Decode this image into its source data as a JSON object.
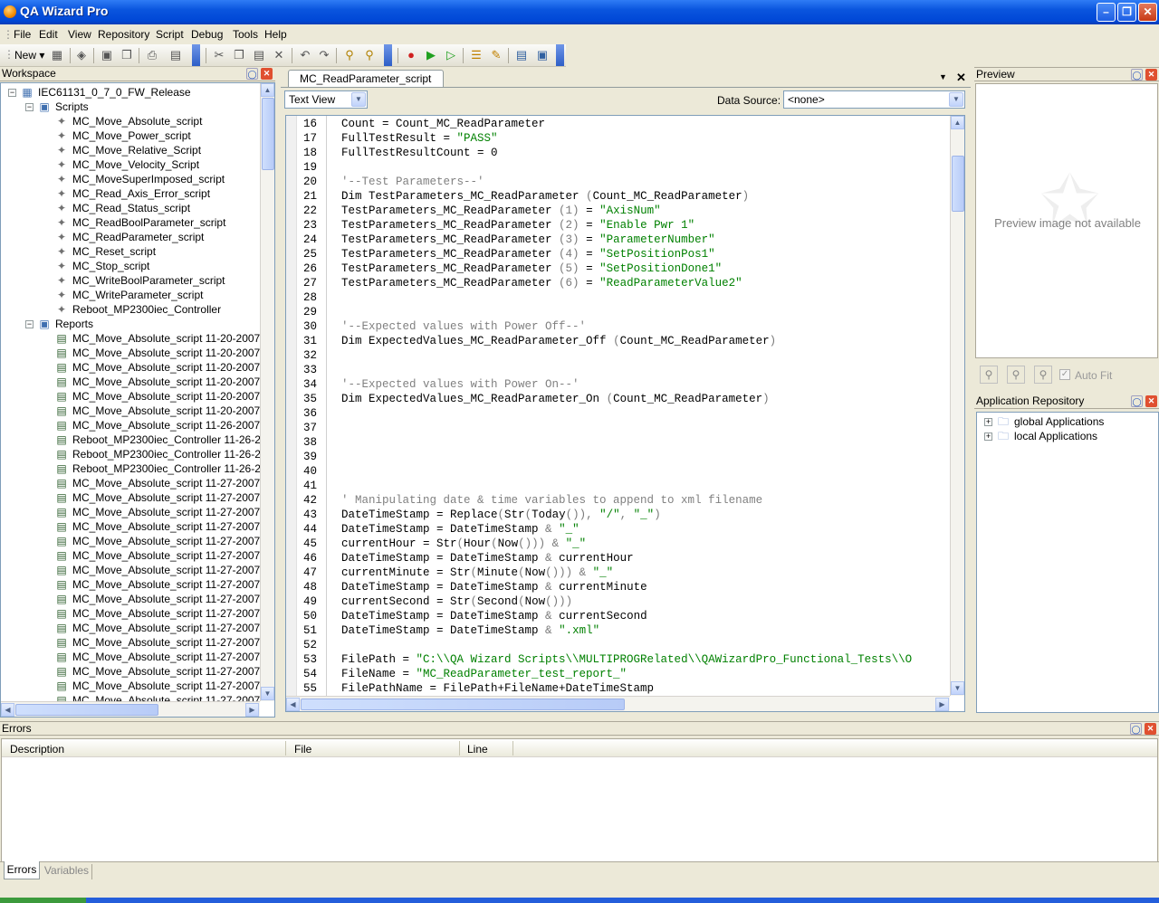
{
  "window": {
    "title": "QA Wizard Pro"
  },
  "menu": [
    "File",
    "Edit",
    "View",
    "Repository",
    "Script",
    "Debug",
    "Tools",
    "Help"
  ],
  "toolbar": {
    "new_label": "New"
  },
  "workspace": {
    "title": "Workspace",
    "root": "IEC61131_0_7_0_FW_Release",
    "scripts_folder": "Scripts",
    "scripts": [
      "MC_Move_Absolute_script",
      "MC_Move_Power_script",
      "MC_Move_Relative_Script",
      "MC_Move_Velocity_Script",
      "MC_MoveSuperImposed_script",
      "MC_Read_Axis_Error_script",
      "MC_Read_Status_script",
      "MC_ReadBoolParameter_script",
      "MC_ReadParameter_script",
      "MC_Reset_script",
      "MC_Stop_script",
      "MC_WriteBoolParameter_script",
      "MC_WriteParameter_script",
      "Reboot_MP2300iec_Controller"
    ],
    "reports_folder": "Reports",
    "reports": [
      "MC_Move_Absolute_script 11-20-2007",
      "MC_Move_Absolute_script 11-20-2007",
      "MC_Move_Absolute_script 11-20-2007",
      "MC_Move_Absolute_script 11-20-2007",
      "MC_Move_Absolute_script 11-20-2007",
      "MC_Move_Absolute_script 11-20-2007",
      "MC_Move_Absolute_script 11-26-2007",
      "Reboot_MP2300iec_Controller 11-26-20",
      "Reboot_MP2300iec_Controller 11-26-20",
      "Reboot_MP2300iec_Controller 11-26-20",
      "MC_Move_Absolute_script 11-27-2007",
      "MC_Move_Absolute_script 11-27-2007",
      "MC_Move_Absolute_script 11-27-2007",
      "MC_Move_Absolute_script 11-27-2007",
      "MC_Move_Absolute_script 11-27-2007",
      "MC_Move_Absolute_script 11-27-2007",
      "MC_Move_Absolute_script 11-27-2007",
      "MC_Move_Absolute_script 11-27-2007",
      "MC_Move_Absolute_script 11-27-2007",
      "MC_Move_Absolute_script 11-27-2007",
      "MC_Move_Absolute_script 11-27-2007",
      "MC_Move_Absolute_script 11-27-2007",
      "MC_Move_Absolute_script 11-27-2007",
      "MC_Move_Absolute_script 11-27-2007",
      "MC_Move_Absolute_script 11-27-2007",
      "MC_Move_Absolute_script 11-27-2007"
    ]
  },
  "editor": {
    "tab": "MC_ReadParameter_script",
    "view_mode": "Text View",
    "data_source_label": "Data Source:",
    "data_source_value": "<none>",
    "lines": [
      {
        "n": "16",
        "segs": [
          [
            "Count = Count_MC_ReadParameter",
            ""
          ]
        ]
      },
      {
        "n": "17",
        "segs": [
          [
            "FullTestResult = ",
            ""
          ],
          [
            "\"PASS\"",
            "str"
          ]
        ]
      },
      {
        "n": "18",
        "segs": [
          [
            "FullTestResultCount = 0",
            ""
          ]
        ]
      },
      {
        "n": "19",
        "segs": []
      },
      {
        "n": "20",
        "segs": [
          [
            "'--Test Parameters--'",
            "cmt"
          ]
        ]
      },
      {
        "n": "21",
        "segs": [
          [
            "Dim TestParameters_MC_ReadParameter ",
            ""
          ],
          [
            "(",
            "pnc"
          ],
          [
            "Count_MC_ReadParameter",
            ""
          ],
          [
            ")",
            "pnc"
          ]
        ]
      },
      {
        "n": "22",
        "segs": [
          [
            "TestParameters_MC_ReadParameter ",
            ""
          ],
          [
            "(1)",
            "pnc"
          ],
          [
            " = ",
            ""
          ],
          [
            "\"AxisNum\"",
            "str"
          ]
        ]
      },
      {
        "n": "23",
        "segs": [
          [
            "TestParameters_MC_ReadParameter ",
            ""
          ],
          [
            "(2)",
            "pnc"
          ],
          [
            " = ",
            ""
          ],
          [
            "\"Enable Pwr 1\"",
            "str"
          ]
        ]
      },
      {
        "n": "24",
        "segs": [
          [
            "TestParameters_MC_ReadParameter ",
            ""
          ],
          [
            "(3)",
            "pnc"
          ],
          [
            " = ",
            ""
          ],
          [
            "\"ParameterNumber\"",
            "str"
          ]
        ]
      },
      {
        "n": "25",
        "segs": [
          [
            "TestParameters_MC_ReadParameter ",
            ""
          ],
          [
            "(4)",
            "pnc"
          ],
          [
            " = ",
            ""
          ],
          [
            "\"SetPositionPos1\"",
            "str"
          ]
        ]
      },
      {
        "n": "26",
        "segs": [
          [
            "TestParameters_MC_ReadParameter ",
            ""
          ],
          [
            "(5)",
            "pnc"
          ],
          [
            " = ",
            ""
          ],
          [
            "\"SetPositionDone1\"",
            "str"
          ]
        ]
      },
      {
        "n": "27",
        "segs": [
          [
            "TestParameters_MC_ReadParameter ",
            ""
          ],
          [
            "(6)",
            "pnc"
          ],
          [
            " = ",
            ""
          ],
          [
            "\"ReadParameterValue2\"",
            "str"
          ]
        ]
      },
      {
        "n": "28",
        "segs": []
      },
      {
        "n": "29",
        "segs": []
      },
      {
        "n": "30",
        "segs": [
          [
            "'--Expected values with Power Off--'",
            "cmt"
          ]
        ]
      },
      {
        "n": "31",
        "segs": [
          [
            "Dim ExpectedValues_MC_ReadParameter_Off ",
            ""
          ],
          [
            "(",
            "pnc"
          ],
          [
            "Count_MC_ReadParameter",
            ""
          ],
          [
            ")",
            "pnc"
          ]
        ]
      },
      {
        "n": "32",
        "segs": []
      },
      {
        "n": "33",
        "segs": []
      },
      {
        "n": "34",
        "segs": [
          [
            "'--Expected values with Power On--'",
            "cmt"
          ]
        ]
      },
      {
        "n": "35",
        "segs": [
          [
            "Dim ExpectedValues_MC_ReadParameter_On ",
            ""
          ],
          [
            "(",
            "pnc"
          ],
          [
            "Count_MC_ReadParameter",
            ""
          ],
          [
            ")",
            "pnc"
          ]
        ]
      },
      {
        "n": "36",
        "segs": []
      },
      {
        "n": "37",
        "segs": []
      },
      {
        "n": "38",
        "segs": []
      },
      {
        "n": "39",
        "segs": []
      },
      {
        "n": "40",
        "segs": []
      },
      {
        "n": "41",
        "segs": []
      },
      {
        "n": "42",
        "segs": [
          [
            "' Manipulating date & time variables to append to xml filename",
            "cmt"
          ]
        ]
      },
      {
        "n": "43",
        "segs": [
          [
            "DateTimeStamp = Replace",
            ""
          ],
          [
            "(",
            "pnc"
          ],
          [
            "Str",
            ""
          ],
          [
            "(",
            "pnc"
          ],
          [
            "Today",
            ""
          ],
          [
            "()),",
            "pnc"
          ],
          [
            " ",
            ""
          ],
          [
            "\"/\"",
            "str"
          ],
          [
            ",",
            "pnc"
          ],
          [
            " ",
            ""
          ],
          [
            "\"_\"",
            "str"
          ],
          [
            ")",
            "pnc"
          ]
        ]
      },
      {
        "n": "44",
        "segs": [
          [
            "DateTimeStamp = DateTimeStamp ",
            ""
          ],
          [
            "&",
            "pnc"
          ],
          [
            " ",
            ""
          ],
          [
            "\"_\"",
            "str"
          ]
        ]
      },
      {
        "n": "45",
        "segs": [
          [
            "currentHour = Str",
            ""
          ],
          [
            "(",
            "pnc"
          ],
          [
            "Hour",
            ""
          ],
          [
            "(",
            "pnc"
          ],
          [
            "Now",
            ""
          ],
          [
            "()))",
            "pnc"
          ],
          [
            " ",
            ""
          ],
          [
            "&",
            "pnc"
          ],
          [
            " ",
            ""
          ],
          [
            "\"_\"",
            "str"
          ]
        ]
      },
      {
        "n": "46",
        "segs": [
          [
            "DateTimeStamp = DateTimeStamp ",
            ""
          ],
          [
            "&",
            "pnc"
          ],
          [
            " currentHour",
            ""
          ]
        ]
      },
      {
        "n": "47",
        "segs": [
          [
            "currentMinute = Str",
            ""
          ],
          [
            "(",
            "pnc"
          ],
          [
            "Minute",
            ""
          ],
          [
            "(",
            "pnc"
          ],
          [
            "Now",
            ""
          ],
          [
            "()))",
            "pnc"
          ],
          [
            " ",
            ""
          ],
          [
            "&",
            "pnc"
          ],
          [
            " ",
            ""
          ],
          [
            "\"_\"",
            "str"
          ]
        ]
      },
      {
        "n": "48",
        "segs": [
          [
            "DateTimeStamp = DateTimeStamp ",
            ""
          ],
          [
            "&",
            "pnc"
          ],
          [
            " currentMinute",
            ""
          ]
        ]
      },
      {
        "n": "49",
        "segs": [
          [
            "currentSecond = Str",
            ""
          ],
          [
            "(",
            "pnc"
          ],
          [
            "Second",
            ""
          ],
          [
            "(",
            "pnc"
          ],
          [
            "Now",
            ""
          ],
          [
            "()))",
            "pnc"
          ]
        ]
      },
      {
        "n": "50",
        "segs": [
          [
            "DateTimeStamp = DateTimeStamp ",
            ""
          ],
          [
            "&",
            "pnc"
          ],
          [
            " currentSecond",
            ""
          ]
        ]
      },
      {
        "n": "51",
        "segs": [
          [
            "DateTimeStamp = DateTimeStamp ",
            ""
          ],
          [
            "&",
            "pnc"
          ],
          [
            " ",
            ""
          ],
          [
            "\".xml\"",
            "str"
          ]
        ]
      },
      {
        "n": "52",
        "segs": []
      },
      {
        "n": "53",
        "segs": [
          [
            "FilePath = ",
            ""
          ],
          [
            "\"C:\\\\QA Wizard Scripts\\\\MULTIPROGRelated\\\\QAWizardPro_Functional_Tests\\\\O",
            "str"
          ]
        ]
      },
      {
        "n": "54",
        "segs": [
          [
            "FileName = ",
            ""
          ],
          [
            "\"MC_ReadParameter_test_report_\"",
            "str"
          ]
        ]
      },
      {
        "n": "55",
        "segs": [
          [
            "FilePathName = FilePath+FileName+DateTimeStamp",
            ""
          ]
        ]
      }
    ]
  },
  "preview": {
    "title": "Preview",
    "message": "Preview image not available",
    "auto_fit": "Auto Fit"
  },
  "app_repo": {
    "title": "Application Repository",
    "items": [
      "global Applications",
      "local Applications"
    ]
  },
  "errors": {
    "title": "Errors",
    "columns": [
      "Description",
      "File",
      "Line"
    ],
    "tabs": [
      "Errors",
      "Variables"
    ]
  }
}
